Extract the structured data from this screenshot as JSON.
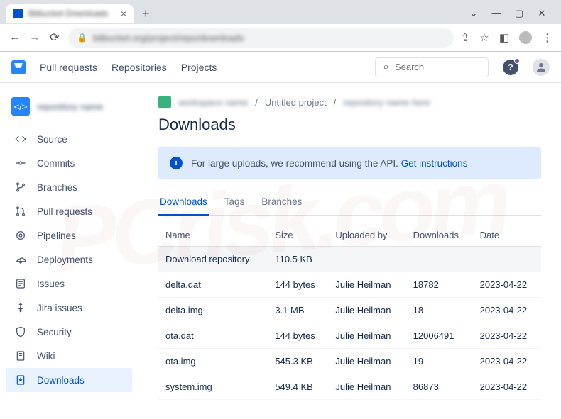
{
  "browser": {
    "tab_title": "Bitbucket Downloads"
  },
  "header": {
    "nav": [
      "Pull requests",
      "Repositories",
      "Projects"
    ],
    "search_placeholder": "Search"
  },
  "sidebar": {
    "repo_name": "repository name",
    "items": [
      {
        "label": "Source",
        "icon": "code"
      },
      {
        "label": "Commits",
        "icon": "commits"
      },
      {
        "label": "Branches",
        "icon": "branches"
      },
      {
        "label": "Pull requests",
        "icon": "pull"
      },
      {
        "label": "Pipelines",
        "icon": "pipe"
      },
      {
        "label": "Deployments",
        "icon": "deploy"
      },
      {
        "label": "Issues",
        "icon": "issues"
      },
      {
        "label": "Jira issues",
        "icon": "jira"
      },
      {
        "label": "Security",
        "icon": "security"
      },
      {
        "label": "Wiki",
        "icon": "wiki"
      },
      {
        "label": "Downloads",
        "icon": "download",
        "active": true
      }
    ]
  },
  "breadcrumb": {
    "project": "Untitled project"
  },
  "page": {
    "title": "Downloads",
    "banner_text": "For large uploads, we recommend using the API. ",
    "banner_link": "Get instructions"
  },
  "tabs": [
    "Downloads",
    "Tags",
    "Branches"
  ],
  "table": {
    "headers": [
      "Name",
      "Size",
      "Uploaded by",
      "Downloads",
      "Date"
    ],
    "rows": [
      {
        "name": "Download repository",
        "size": "110.5 KB",
        "by": "",
        "dl": "",
        "date": "",
        "hl": true
      },
      {
        "name": "delta.dat",
        "size": "144 bytes",
        "by": "Julie Heilman",
        "dl": "18782",
        "date": "2023-04-22"
      },
      {
        "name": "delta.img",
        "size": "3.1 MB",
        "by": "Julie Heilman",
        "dl": "18",
        "date": "2023-04-22"
      },
      {
        "name": "ota.dat",
        "size": "144 bytes",
        "by": "Julie Heilman",
        "dl": "12006491",
        "date": "2023-04-22"
      },
      {
        "name": "ota.img",
        "size": "545.3 KB",
        "by": "Julie Heilman",
        "dl": "19",
        "date": "2023-04-22"
      },
      {
        "name": "system.img",
        "size": "549.4 KB",
        "by": "Julie Heilman",
        "dl": "86873",
        "date": "2023-04-22"
      }
    ]
  }
}
